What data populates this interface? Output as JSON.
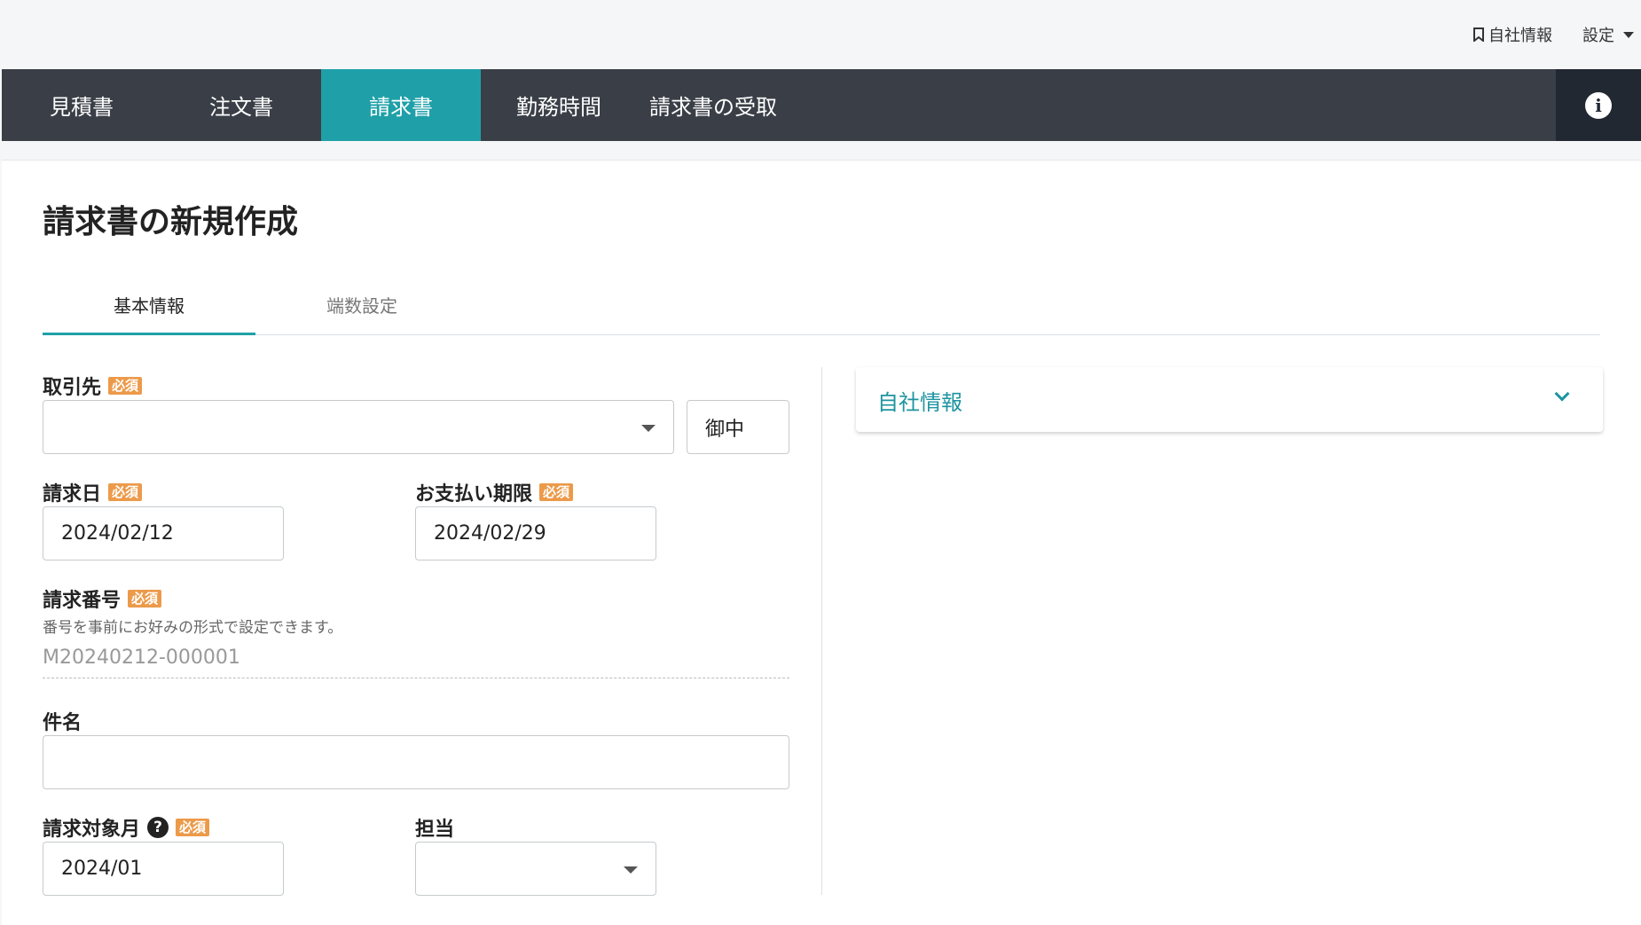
{
  "topbar": {
    "company_info_label": "自社情報",
    "settings_label": "設定"
  },
  "nav": {
    "tabs": [
      {
        "label": "見積書"
      },
      {
        "label": "注文書"
      },
      {
        "label": "請求書",
        "active": true
      },
      {
        "label": "勤務時間"
      },
      {
        "label": "請求書の受取"
      }
    ],
    "info_icon": "info-icon"
  },
  "page": {
    "title": "請求書の新規作成",
    "subtabs": [
      {
        "label": "基本情報",
        "active": true
      },
      {
        "label": "端数設定"
      }
    ]
  },
  "form": {
    "required_badge": "必須",
    "client": {
      "label": "取引先",
      "value": "",
      "honorific": "御中"
    },
    "invoice_date": {
      "label": "請求日",
      "value": "2024/02/12"
    },
    "due_date": {
      "label": "お支払い期限",
      "value": "2024/02/29"
    },
    "invoice_number": {
      "label": "請求番号",
      "hint": "番号を事前にお好みの形式で設定できます。",
      "value": "M20240212-000001"
    },
    "subject": {
      "label": "件名",
      "value": ""
    },
    "target_month": {
      "label": "請求対象月",
      "value": "2024/01"
    },
    "person_in_charge": {
      "label": "担当",
      "value": ""
    }
  },
  "sidebar": {
    "accordion_title": "自社情報"
  },
  "colors": {
    "nav_bg": "#3a3f47",
    "accent": "#1fa0a8",
    "required_badge": "#ec9a4a"
  }
}
